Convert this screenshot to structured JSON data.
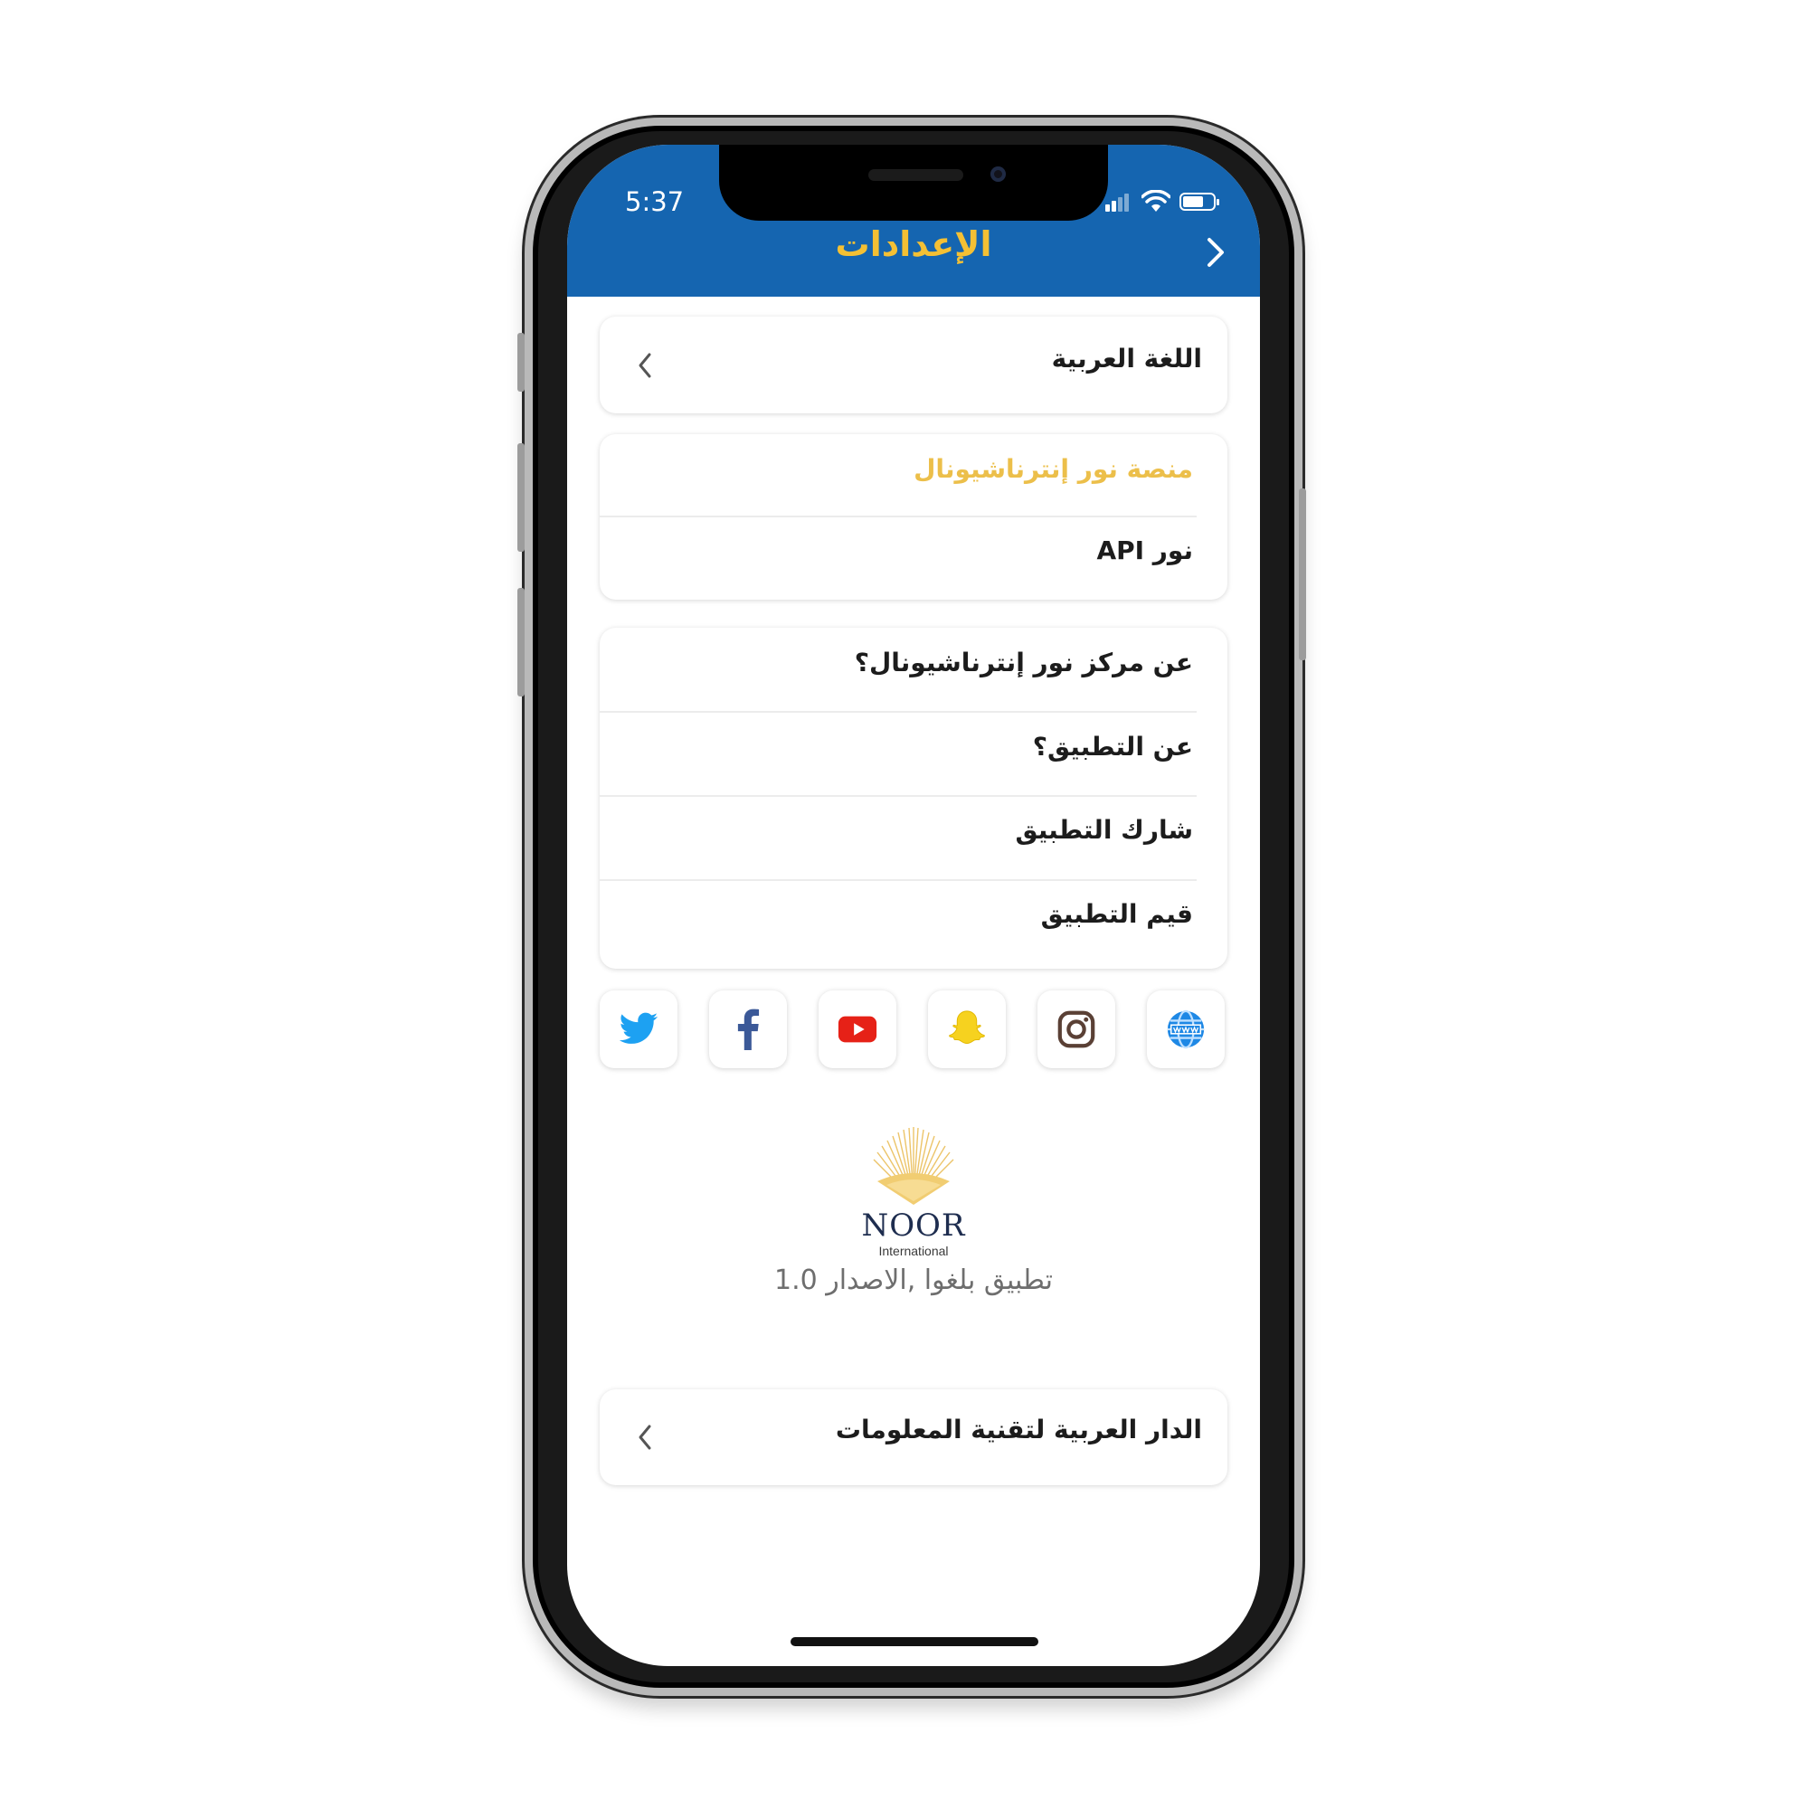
{
  "status_bar": {
    "time": "5:37"
  },
  "header": {
    "title": "الإعدادات",
    "accent_color": "#f4c034",
    "background_color": "#1565b0",
    "back_icon": "chevron-right-icon"
  },
  "language": {
    "label": "اللغة العربية",
    "icon": "chevron-left-icon"
  },
  "platform": {
    "title": "منصة نور إنترناشيونال",
    "title_color": "#ecbf4a",
    "items": [
      {
        "label": "نور API"
      }
    ]
  },
  "about": {
    "items": [
      {
        "label": "عن مركز نور إنترناشيونال؟"
      },
      {
        "label": "عن التطبيق؟"
      },
      {
        "label": "شارك التطبيق"
      },
      {
        "label": "قيم التطبيق"
      }
    ]
  },
  "social": {
    "icons": [
      "twitter-icon",
      "facebook-icon",
      "youtube-icon",
      "snapchat-icon",
      "instagram-icon",
      "globe-icon"
    ],
    "colors": {
      "twitter": "#1da1f2",
      "facebook": "#3b5998",
      "youtube": "#e62117",
      "snapchat": "#fffc00",
      "instagram": "#5a4035",
      "globe": "#1e88e5"
    }
  },
  "brand": {
    "name": "NOOR",
    "subtitle": "International",
    "version_text": "تطبيق بلغوا ,الاصدار 1.0"
  },
  "developer": {
    "label": "الدار العربية لتقنية المعلومات",
    "icon": "chevron-left-icon"
  }
}
